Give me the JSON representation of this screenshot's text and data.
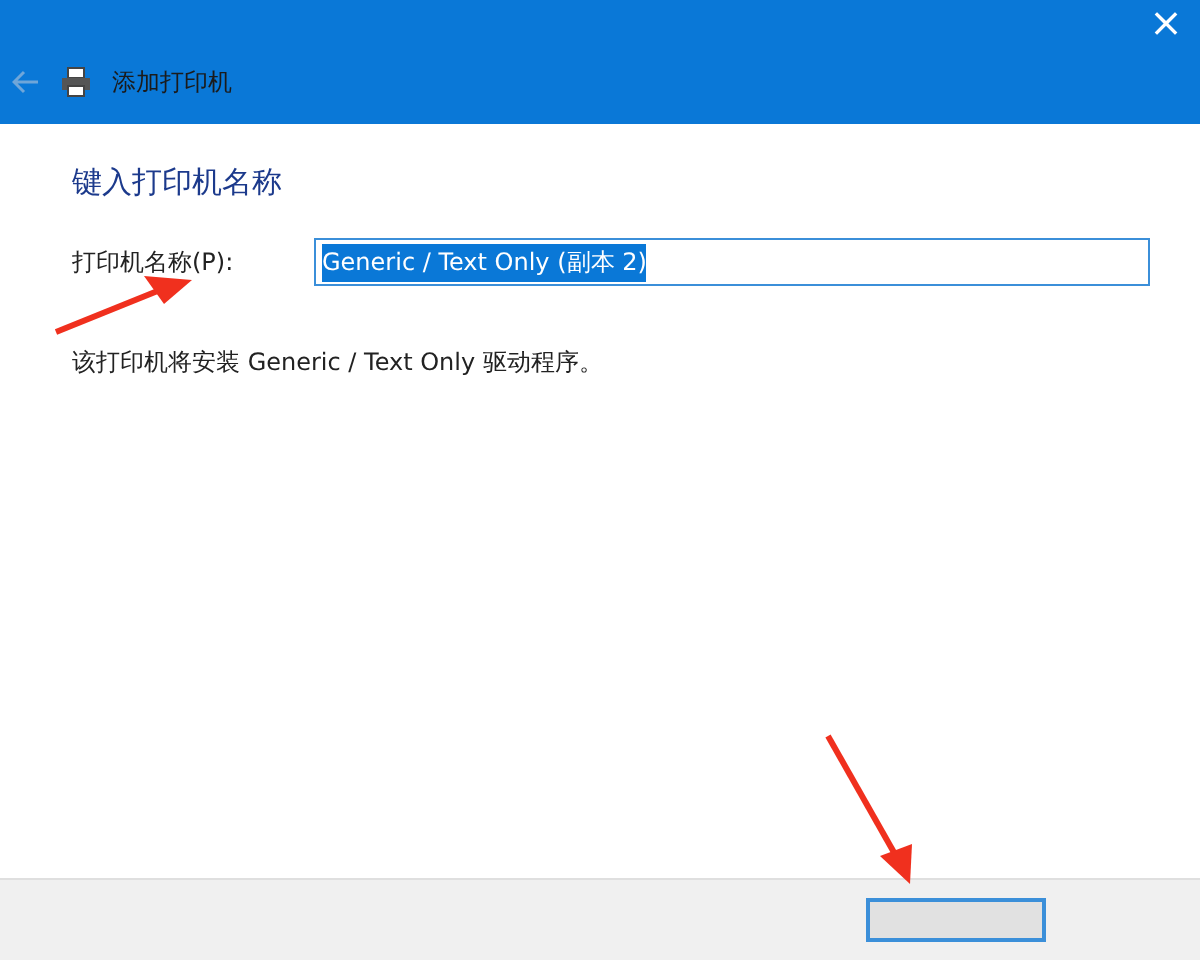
{
  "window": {
    "title": "添加打印机",
    "close": "×"
  },
  "heading": "键入打印机名称",
  "name_field": {
    "label": "打印机名称(P):",
    "value": "Generic / Text Only (副本 2)",
    "text_selected": true
  },
  "description": "该打印机将安装 Generic / Text Only 驱动程序。"
}
